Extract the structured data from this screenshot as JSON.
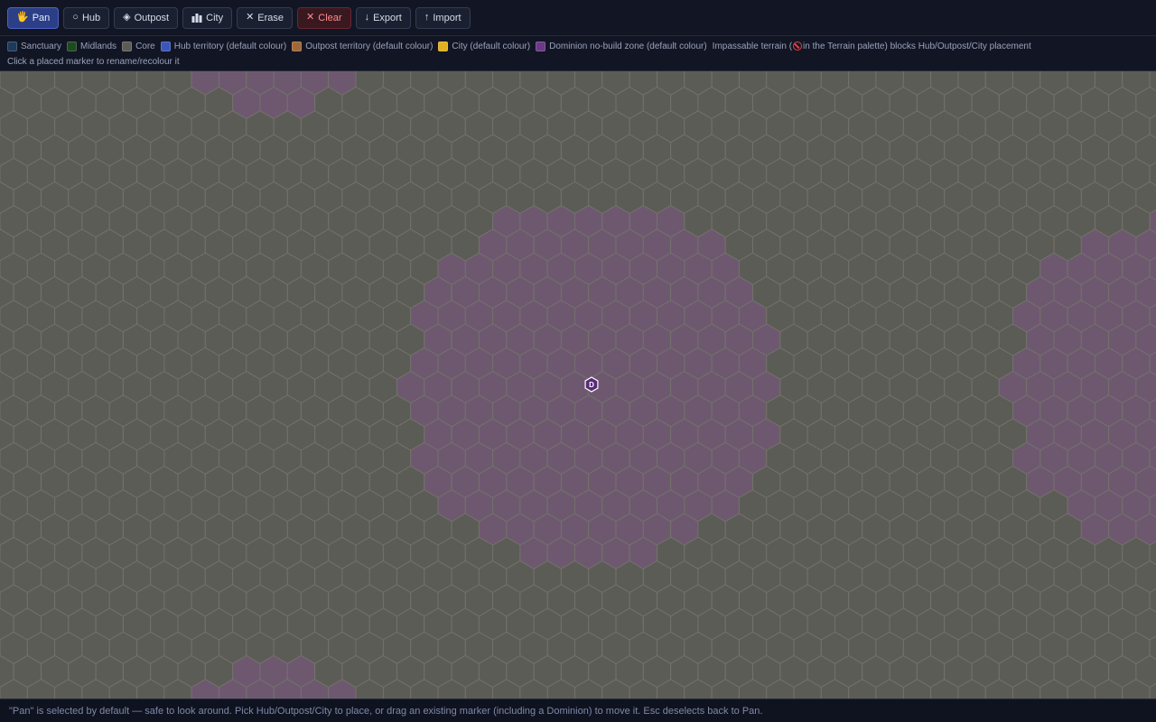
{
  "toolbar": {
    "buttons": [
      {
        "id": "pan",
        "label": "Pan",
        "icon": "hand-icon",
        "state": "active"
      },
      {
        "id": "hub",
        "label": "Hub",
        "icon": "circle-icon",
        "state": "normal"
      },
      {
        "id": "outpost",
        "label": "Outpost",
        "icon": "diamond-icon",
        "state": "normal"
      },
      {
        "id": "city",
        "label": "City",
        "icon": "city-icon",
        "state": "normal"
      },
      {
        "id": "erase",
        "label": "Erase",
        "icon": "x-icon",
        "state": "normal"
      },
      {
        "id": "clear",
        "label": "Clear",
        "icon": "x-icon",
        "state": "danger"
      },
      {
        "id": "export",
        "label": "Export",
        "icon": "arrow-down-icon",
        "state": "normal"
      },
      {
        "id": "import",
        "label": "Import",
        "icon": "arrow-up-icon",
        "state": "normal"
      }
    ]
  },
  "legend": {
    "items": [
      {
        "label": "Sanctuary",
        "color": "#1e3a5a"
      },
      {
        "label": "Midlands",
        "color": "#1e4a22"
      },
      {
        "label": "Core",
        "color": "#5c5c56"
      },
      {
        "label": "Hub territory (default colour)",
        "color": "#3a56b8"
      },
      {
        "label": "Outpost territory (default colour)",
        "color": "#a0683a"
      },
      {
        "label": "City (default colour)",
        "color": "#e0b020"
      },
      {
        "label": "Dominion no-build zone (default colour)",
        "color": "#6a3a86"
      }
    ],
    "impassable_prefix": "Impassable terrain (",
    "impassable_suffix": " in the Terrain palette) blocks Hub/Outpost/City placement",
    "hint": "Click a placed marker to rename/recolour it"
  },
  "map": {
    "core_color": "#5c5c56",
    "zone_color": "#6e5870",
    "grid_line_color": "#72726a",
    "marker": {
      "letter": "D",
      "icon": "dominion-marker-icon"
    }
  },
  "status": {
    "text": "\"Pan\" is selected by default — safe to look around. Pick Hub/Outpost/City to place, or drag an existing marker (including a Dominion) to move it. Esc deselects back to Pan."
  }
}
